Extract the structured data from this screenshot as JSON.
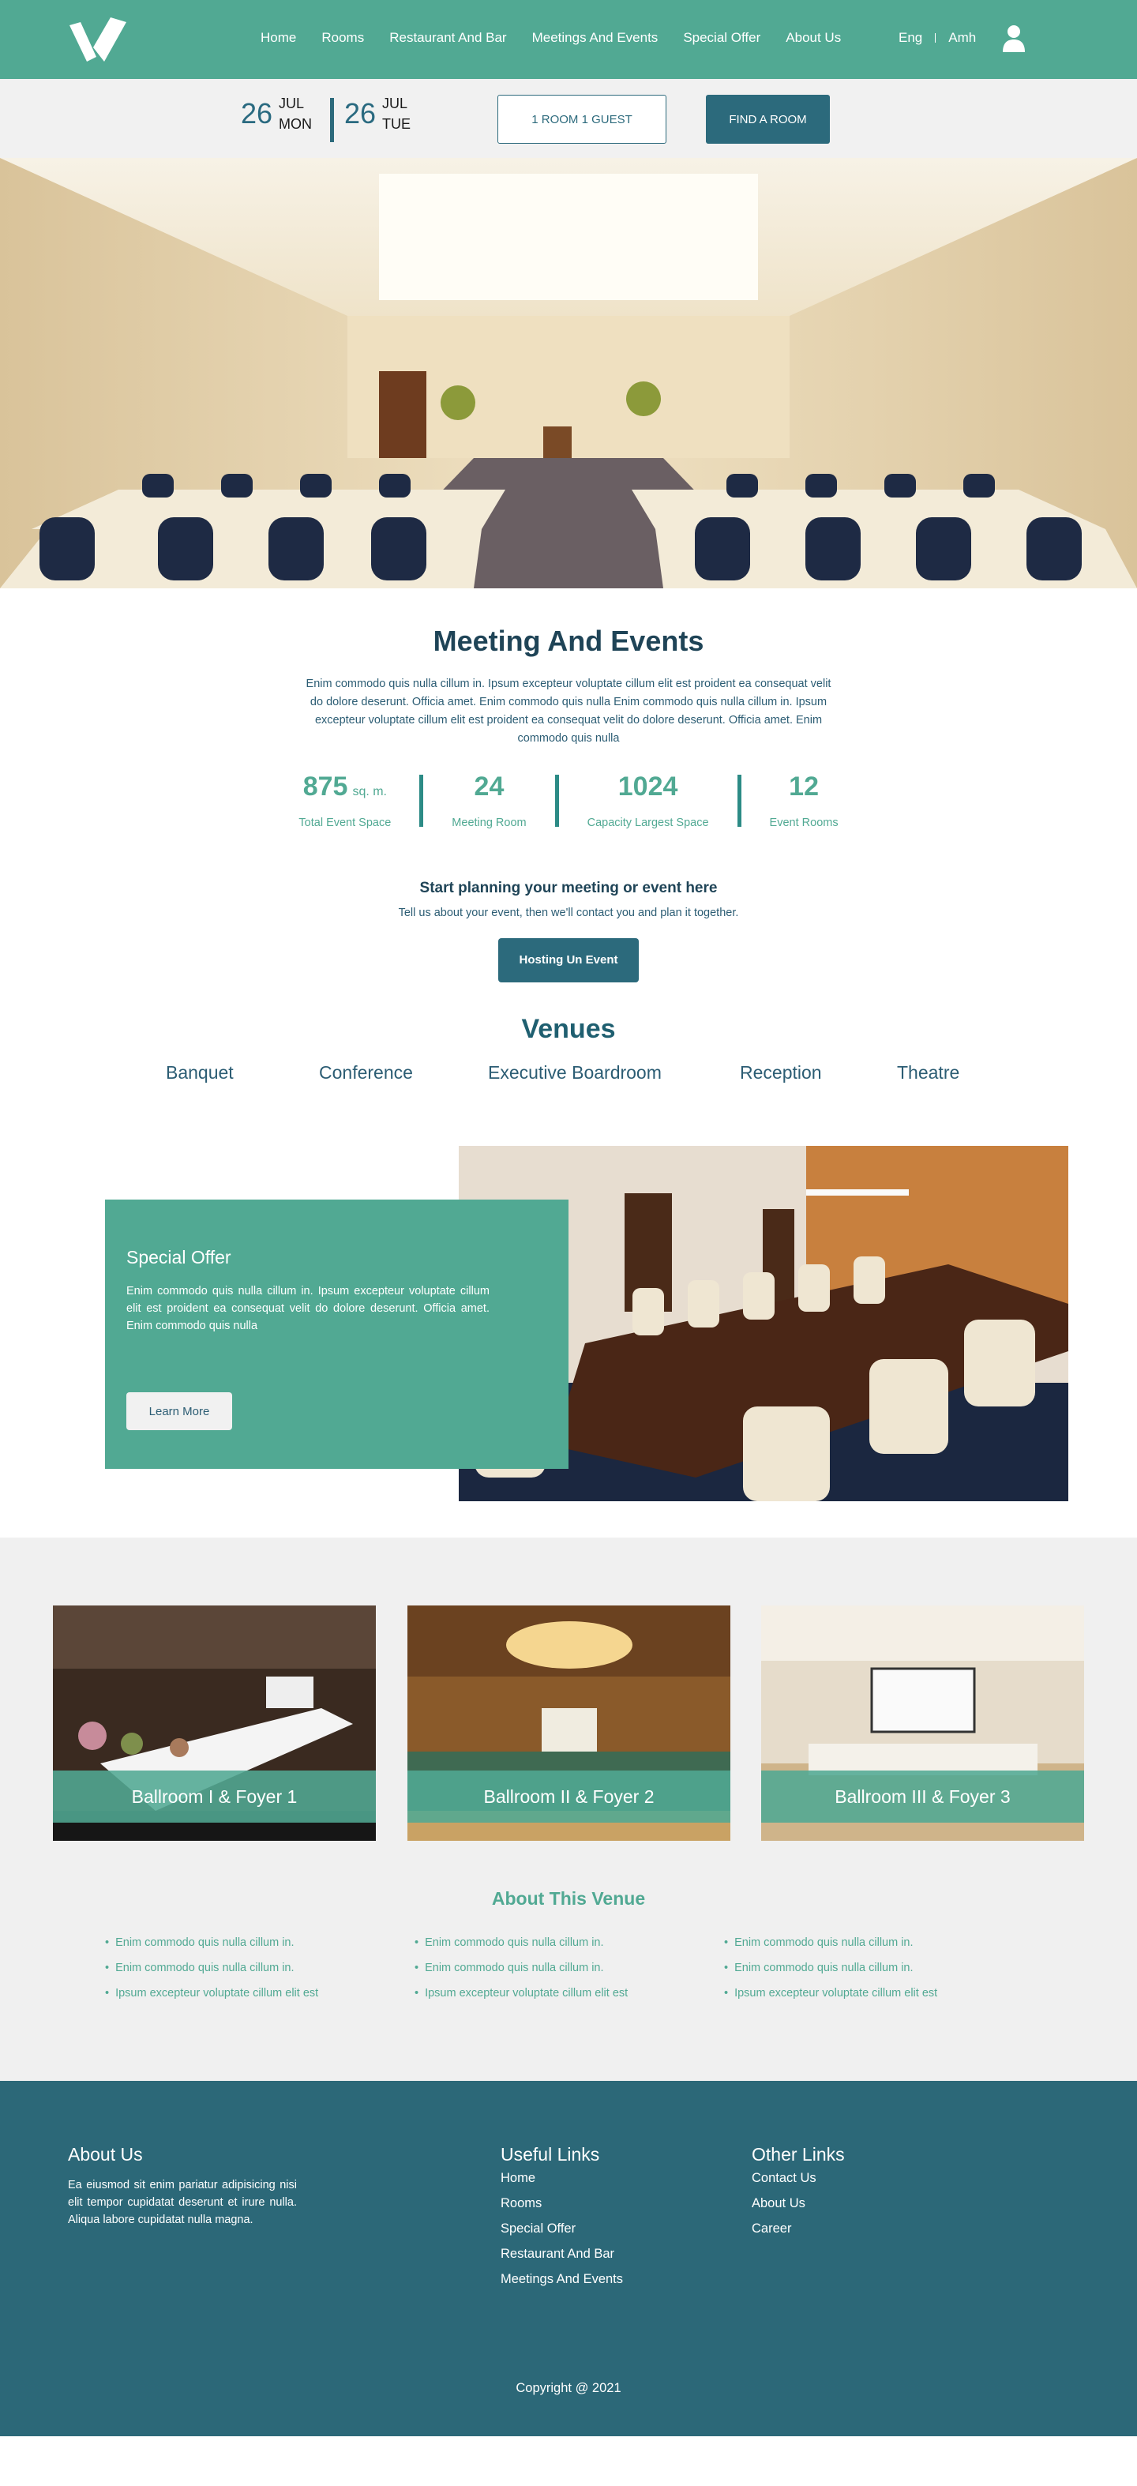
{
  "header": {
    "nav": [
      "Home",
      "Rooms",
      "Restaurant And Bar",
      "Meetings And Events",
      "Special Offer",
      "About Us"
    ],
    "lang_en": "Eng",
    "lang_am": "Amh"
  },
  "booking": {
    "checkin": {
      "day": "26",
      "month": "JUL",
      "weekday": "MON"
    },
    "checkout": {
      "day": "26",
      "month": "JUL",
      "weekday": "TUE"
    },
    "rooms_label": "1 ROOM 1 GUEST",
    "find_label": "FIND A ROOM"
  },
  "meeting": {
    "title": "Meeting And Events",
    "description": "Enim commodo quis nulla cillum in. Ipsum excepteur voluptate cillum elit est proident ea consequat velit do dolore deserunt. Officia amet. Enim commodo quis nulla  Enim commodo quis nulla cillum in. Ipsum excepteur voluptate cillum elit est proident ea consequat velit do dolore deserunt. Officia amet. Enim commodo quis nulla",
    "stats": [
      {
        "value": "875",
        "unit": "sq. m.",
        "label": "Total Event Space"
      },
      {
        "value": "24",
        "unit": "",
        "label": "Meeting Room"
      },
      {
        "value": "1024",
        "unit": "",
        "label": "Capacity Largest Space"
      },
      {
        "value": "12",
        "unit": "",
        "label": "Event Rooms"
      }
    ],
    "plan_title": "Start planning your meeting or event here",
    "plan_sub": "Tell us about your event, then we'll contact you and plan it together.",
    "host_button": "Hosting Un Event"
  },
  "venues": {
    "title": "Venues",
    "tabs": [
      "Banquet",
      "Conference",
      "Executive Boardroom",
      "Reception",
      "Theatre"
    ]
  },
  "offer": {
    "title": "Special Offer",
    "text": "Enim commodo quis nulla cillum in. Ipsum excepteur voluptate cillum elit est proident ea consequat velit do dolore deserunt. Officia amet. Enim commodo quis nulla",
    "button": "Learn More"
  },
  "ballrooms": [
    "Ballroom I & Foyer 1",
    "Ballroom II & Foyer 2",
    "Ballroom III & Foyer 3"
  ],
  "about_venue": {
    "title": "About This Venue",
    "columns": [
      [
        "Enim commodo quis nulla cillum in.",
        "Enim commodo quis nulla cillum in.",
        "Ipsum excepteur voluptate cillum elit est"
      ],
      [
        "Enim commodo quis nulla cillum in.",
        "Enim commodo quis nulla cillum in.",
        "Ipsum excepteur voluptate cillum elit est"
      ],
      [
        "Enim commodo quis nulla cillum in.",
        "Enim commodo quis nulla cillum in.",
        "Ipsum excepteur voluptate cillum elit est"
      ]
    ]
  },
  "footer": {
    "about_title": "About Us",
    "about_text": "Ea eiusmod sit enim pariatur adipisicing nisi elit tempor cupidatat deserunt et irure nulla. Aliqua labore cupidatat nulla magna.",
    "useful_title": "Useful Links",
    "useful_links": [
      "Home",
      "Rooms",
      "Special Offer",
      "Restaurant And Bar",
      "Meetings And Events"
    ],
    "other_title": "Other Links",
    "other_links": [
      "Contact Us",
      "About Us",
      "Career"
    ],
    "copyright": "Copyright @ 2021"
  },
  "colors": {
    "primary_green": "#51a993",
    "dark_teal": "#2c6a7c",
    "navy_text": "#1f4457",
    "light_gray": "#f1f1f1"
  }
}
